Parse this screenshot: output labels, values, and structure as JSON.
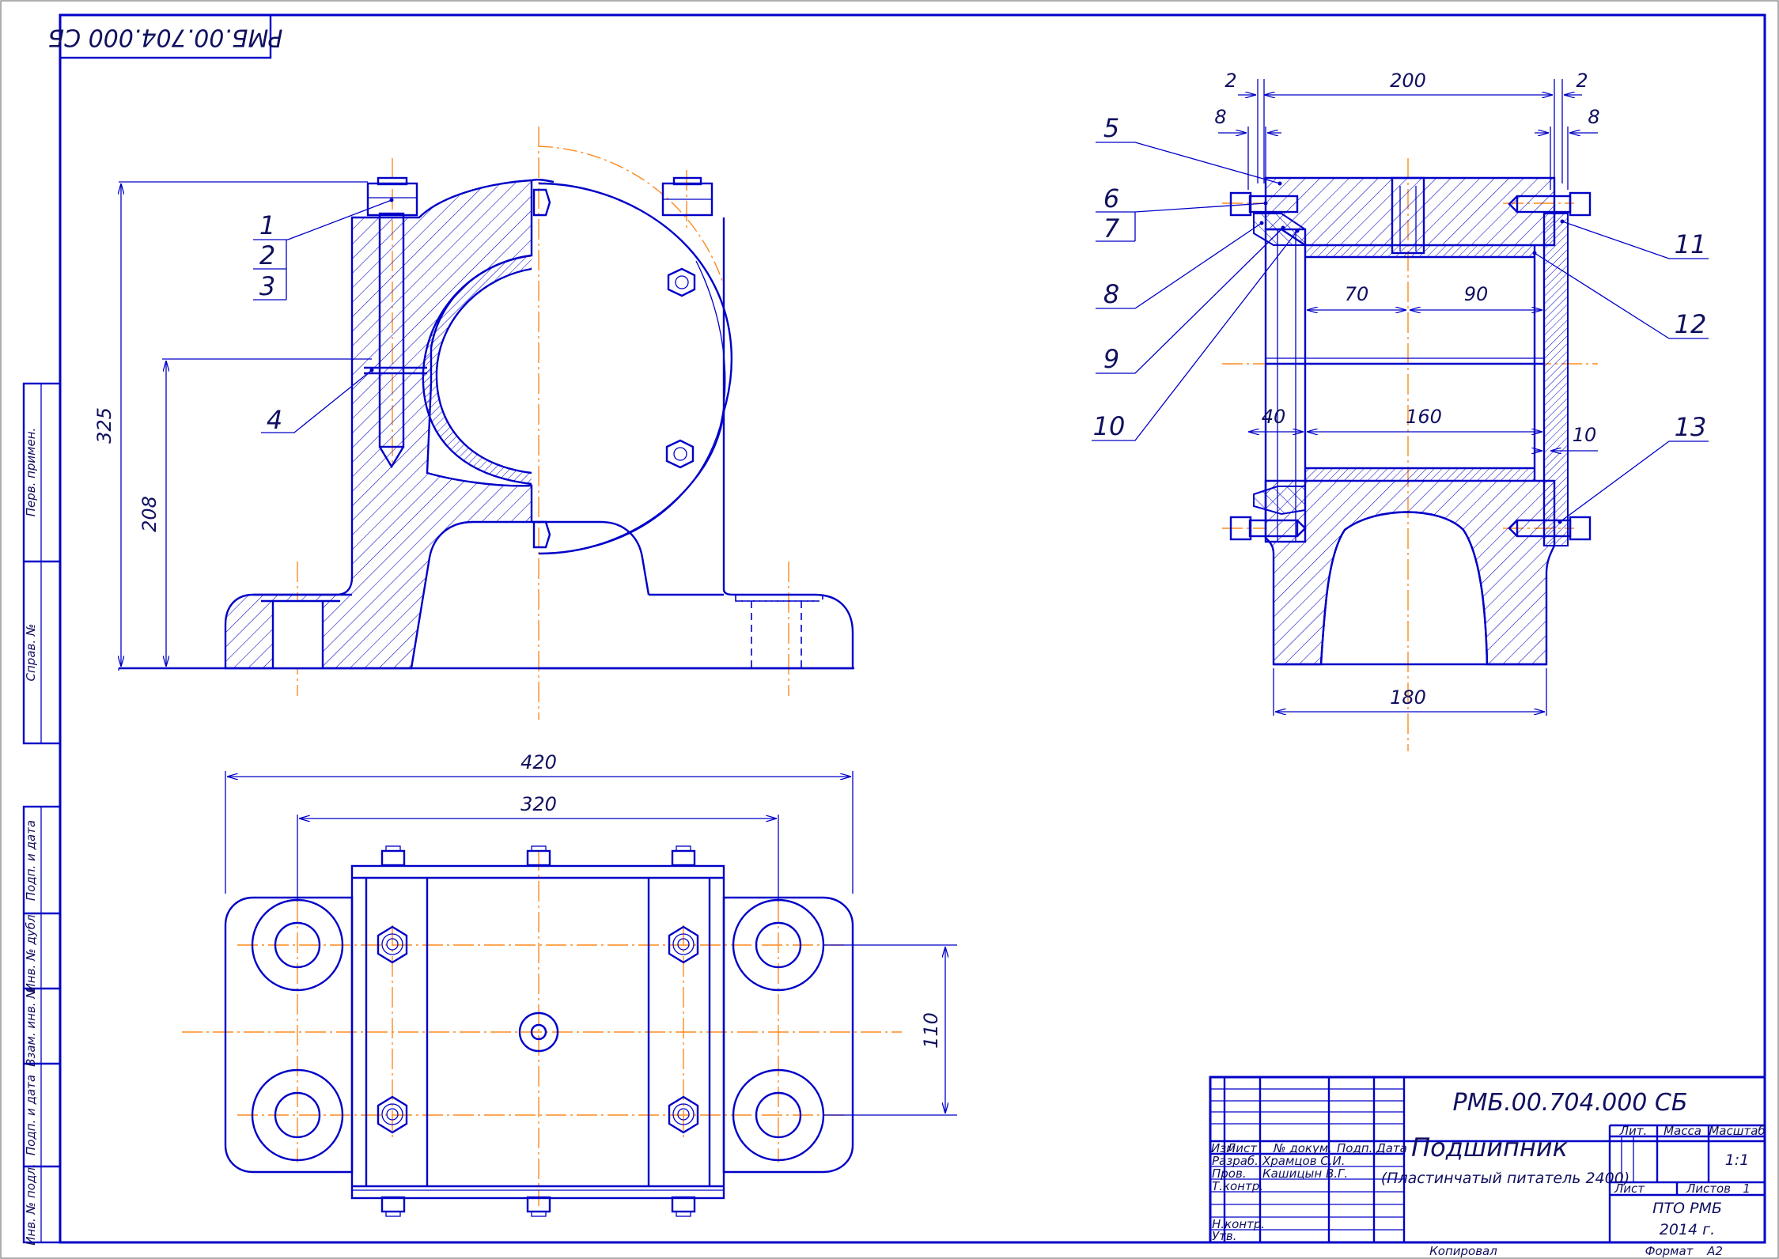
{
  "title_block": {
    "designation": "РМБ.00.704.000 СБ",
    "designation_rotated": "РМБ.00.704.000 СБ",
    "name": "Подшипник",
    "subname": "(Пластинчатый питатель 2400)",
    "col_izm": "Изм",
    "col_list": "Лист",
    "col_doc": "№ докум.",
    "col_sign": "Подп.",
    "col_date": "Дата",
    "row_razrab": "Разраб.",
    "row_prov": "Пров.",
    "row_tkontr": "Т.контр.",
    "row_nkontr": "Н.контр.",
    "row_utv": "Утв.",
    "razrab_name": "Храмцов С.И.",
    "prov_name": "Кашицын В.Г.",
    "lit_label": "Лит.",
    "mass_label": "Масса",
    "scale_label": "Масштаб",
    "scale_value": "1:1",
    "sheet_label": "Лист",
    "sheets_label": "Листов",
    "sheets_value": "1",
    "org": "ПТО РМБ",
    "year": "2014 г.",
    "copied": "Копировал",
    "format_label": "Формат",
    "format_value": "А2"
  },
  "side_strip": {
    "perv_primen": "Перв. примен.",
    "sprav_no": "Справ. №",
    "podp_data_1": "Подп. и дата",
    "inv_dubl": "Инв. № дубл.",
    "vzam_inv": "Взам. инв. №",
    "podp_data_2": "Подп. и дата",
    "inv_podl": "Инв. № подл."
  },
  "dimensions": {
    "d_325": "325",
    "d_208": "208",
    "d_420": "420",
    "d_320": "320",
    "d_110": "110",
    "d_200": "200",
    "d_2a": "2",
    "d_2b": "2",
    "d_8a": "8",
    "d_8b": "8",
    "d_70": "70",
    "d_90": "90",
    "d_40": "40",
    "d_160": "160",
    "d_10": "10",
    "d_180": "180"
  },
  "positions": {
    "p1": "1",
    "p2": "2",
    "p3": "3",
    "p4": "4",
    "p5": "5",
    "p6": "6",
    "p7": "7",
    "p8": "8",
    "p9": "9",
    "p10": "10",
    "p11": "11",
    "p12": "12",
    "p13": "13"
  },
  "colors": {
    "line": "#0000c8",
    "centerline": "#ff8a1f",
    "text": "#101060",
    "background": "#ffffff"
  }
}
